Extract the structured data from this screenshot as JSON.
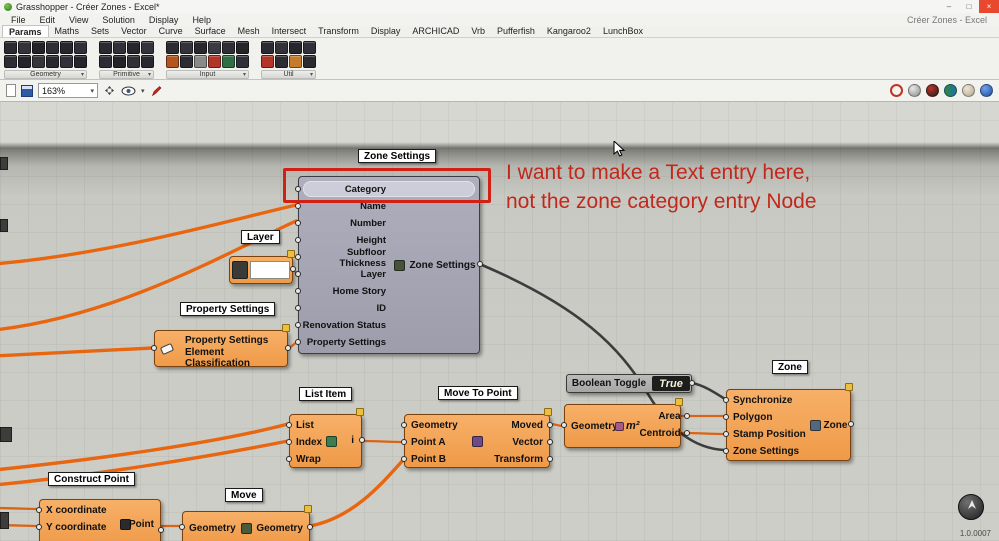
{
  "window": {
    "title": "Grasshopper - Créer Zones - Excel*",
    "minimize": "–",
    "maximize": "□",
    "close": "×"
  },
  "menubar": {
    "items": [
      "File",
      "Edit",
      "View",
      "Solution",
      "Display",
      "Help"
    ],
    "right_text": "Créer Zones - Excel"
  },
  "tabbar": {
    "tabs": [
      "Params",
      "Maths",
      "Sets",
      "Vector",
      "Curve",
      "Surface",
      "Mesh",
      "Intersect",
      "Transform",
      "Display",
      "ARCHICAD",
      "Vrb",
      "Pufferfish",
      "Kangaroo2",
      "LunchBox"
    ],
    "active": "Params"
  },
  "ribbon": {
    "groups": [
      {
        "label": "Geometry",
        "row1": [
          "#2a2a30",
          "#33333a",
          "#222228",
          "#2e2e34",
          "#26262c",
          "#30303a"
        ],
        "row2": [
          "#2d2d33",
          "#232329",
          "#35353b",
          "#28282e",
          "#31313b",
          "#24242a"
        ]
      },
      {
        "label": "Primitive",
        "row1": [
          "#2a2a30",
          "#303038",
          "#26262c",
          "#34343c"
        ],
        "row2": [
          "#2c2c34",
          "#222228",
          "#303036",
          "#282830"
        ]
      },
      {
        "label": "Input",
        "row1": [
          "#2b2b31",
          "#333339",
          "#27272d",
          "#3a3a42",
          "#2e2e36",
          "#242429"
        ],
        "row2": [
          "#b4541e",
          "#2c2c32",
          "#8a8a88",
          "#b23527",
          "#2f6f46",
          "#30303a"
        ]
      },
      {
        "label": "Util",
        "row1": [
          "#2a2a30",
          "#323238",
          "#26262c",
          "#30303a"
        ],
        "row2": [
          "#b23527",
          "#2c2c32",
          "#c77b2a",
          "#2a2a30"
        ]
      }
    ]
  },
  "toolbar": {
    "zoom": "163%",
    "zoom_arrow": "▾",
    "eye_arrow": "▾"
  },
  "annotation": {
    "line1": "I want to make a Text entry here,",
    "line2": "not the zone category entry Node",
    "color": "#c1281b"
  },
  "nodes": {
    "zone_settings": {
      "tag": "Zone Settings",
      "inputs": [
        "Category",
        "Name",
        "Number",
        "Height",
        "Subfloor Thickness",
        "Layer",
        "Home Story",
        "ID",
        "Renovation Status",
        "Property Settings"
      ],
      "output": "Zone Settings"
    },
    "layer": {
      "tag": "Layer",
      "value": ""
    },
    "property_settings": {
      "tag": "Property Settings",
      "rows": [
        "Property Settings",
        "Element Classification"
      ]
    },
    "list_item": {
      "tag": "List Item",
      "inputs": [
        "List",
        "Index",
        "Wrap"
      ],
      "output": "i"
    },
    "move_to_point": {
      "tag": "Move To Point",
      "rows": [
        {
          "in": "Geometry",
          "out": "Moved"
        },
        {
          "in": "Point A",
          "out": "Vector"
        },
        {
          "in": "Point B",
          "out": "Transform"
        }
      ]
    },
    "boolean_toggle": {
      "label": "Boolean Toggle",
      "value": "True"
    },
    "area": {
      "input": "Geometry",
      "icon": "m²",
      "outputs": [
        "Area",
        "Centroid"
      ]
    },
    "zone": {
      "tag": "Zone",
      "inputs": [
        "Synchronize",
        "Polygon",
        "Stamp Position",
        "Zone Settings"
      ],
      "output": "Zone"
    },
    "construct_point": {
      "tag": "Construct Point",
      "inputs": [
        "X coordinate",
        "Y coordinate"
      ],
      "output": "Point"
    },
    "move": {
      "tag": "Move",
      "input": "Geometry",
      "output": "Geometry"
    }
  },
  "status": {
    "version": "1.0.0007"
  },
  "colors": {
    "wire_orange": "#e8660f",
    "wire_dark": "#3c3c3c",
    "node_orange": "#f2a355",
    "node_gray": "#a6a6b4",
    "selection_red": "#d22114",
    "annotation_red": "#c1281b"
  }
}
